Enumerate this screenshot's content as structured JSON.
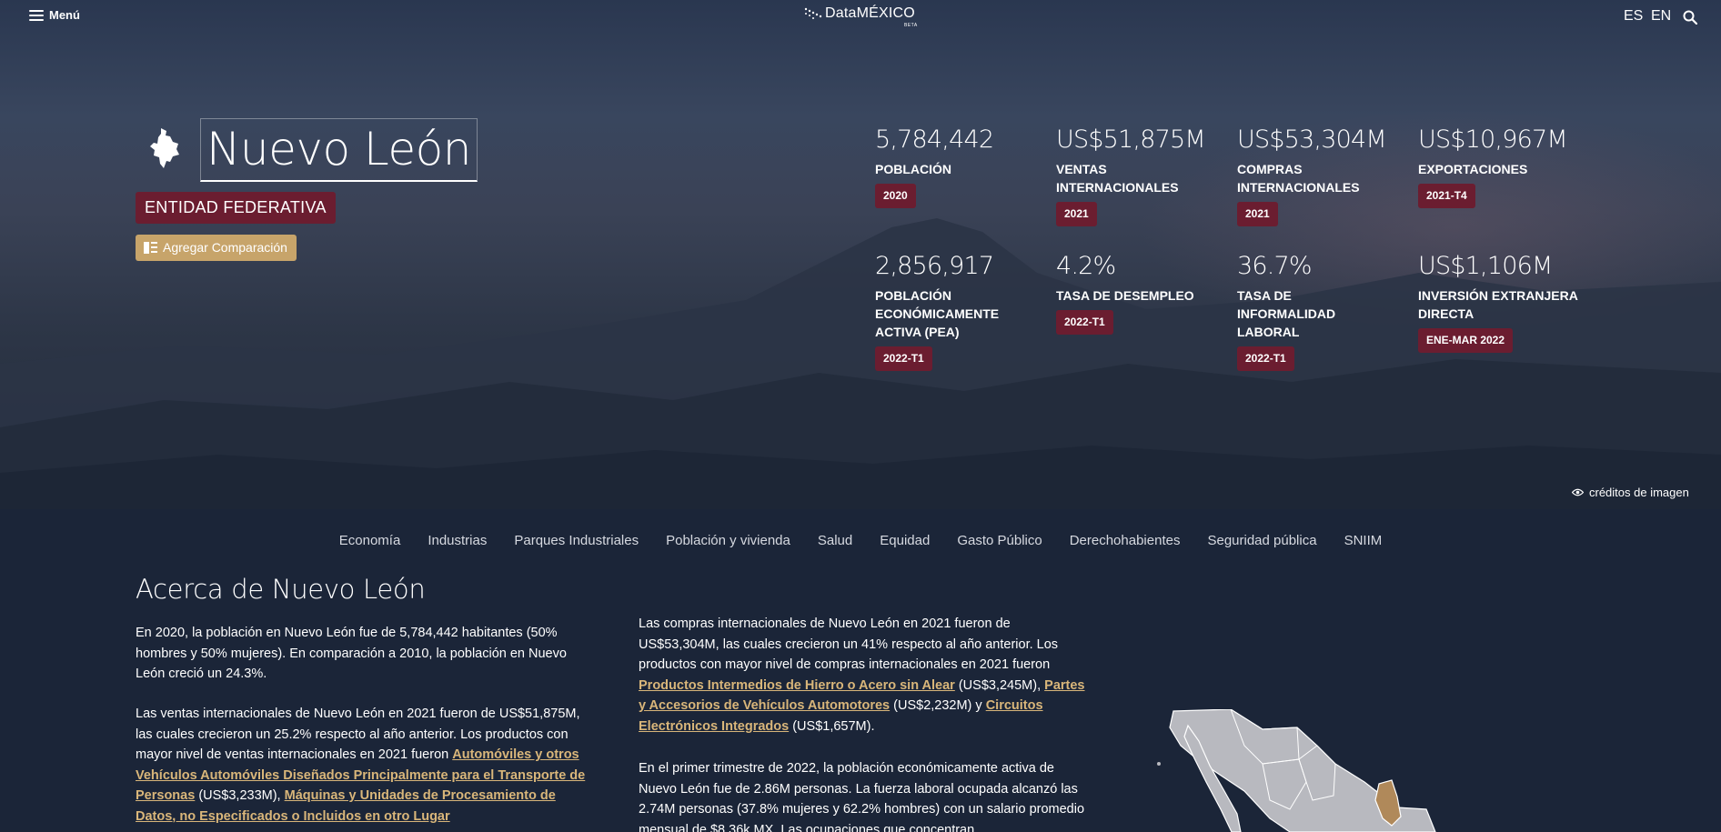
{
  "header": {
    "menu_label": "Menú",
    "logo_text": "DataMÉXICO",
    "logo_beta": "BETA",
    "lang_es": "ES",
    "lang_en": "EN"
  },
  "profile": {
    "title": "Nuevo León",
    "entity_type": "ENTIDAD FEDERATIVA",
    "compare_label": "Agregar Comparación"
  },
  "stats": [
    {
      "value": "5,784,442",
      "label": "POBLACIÓN",
      "badge": "2020"
    },
    {
      "value": "US$51,875M",
      "label": "VENTAS INTERNACIONALES",
      "badge": "2021"
    },
    {
      "value": "US$53,304M",
      "label": "COMPRAS INTERNACIONALES",
      "badge": "2021"
    },
    {
      "value": "US$10,967M",
      "label": "EXPORTACIONES",
      "badge": "2021-T4"
    },
    {
      "value": "2,856,917",
      "label": "POBLACIÓN ECONÓMICAMENTE ACTIVA (PEA)",
      "badge": "2022-T1"
    },
    {
      "value": "4.2%",
      "label": "TASA DE DESEMPLEO",
      "badge": "2022-T1"
    },
    {
      "value": "36.7%",
      "label": "TASA DE INFORMALIDAD LABORAL",
      "badge": "2022-T1"
    },
    {
      "value": "US$1,106M",
      "label": "INVERSIÓN EXTRANJERA DIRECTA",
      "badge": "ENE-MAR 2022"
    }
  ],
  "credits_label": "créditos de imagen",
  "nav": [
    "Economía",
    "Industrias",
    "Parques Industriales",
    "Población y vivienda",
    "Salud",
    "Equidad",
    "Gasto Público",
    "Derechohabientes",
    "Seguridad pública",
    "SNIIM"
  ],
  "about": {
    "title": "Acerca de Nuevo León",
    "p1": "En 2020, la población en Nuevo León fue de 5,784,442 habitantes (50% hombres y 50% mujeres). En comparación a 2010, la población en Nuevo León creció un 24.3%.",
    "p2_text": "Las ventas internacionales de Nuevo León en 2021 fueron de US$51,875M, las cuales crecieron un 25.2% respecto al año anterior. Los productos con mayor nivel de ventas internacionales en 2021 fueron ",
    "p2_link1": "Automóviles y otros Vehículos Automóviles Diseñados Principalmente para el Transporte de Personas",
    "p2_mid": " (US$3,233M), ",
    "p2_link2": "Máquinas y Unidades de Procesamiento de Datos, no Especificados o Incluidos en otro Lugar",
    "p3_text": "Las compras internacionales de Nuevo León en 2021 fueron de US$53,304M, las cuales crecieron un 41% respecto al año anterior. Los productos con mayor nivel de compras internacionales en 2021 fueron ",
    "p3_link1": "Productos Intermedios de Hierro o Acero sin Alear",
    "p3_mid1": " (US$3,245M), ",
    "p3_link2": "Partes y Accesorios de Vehículos Automotores",
    "p3_mid2": " (US$2,232M) y ",
    "p3_link3": "Circuitos Electrónicos Integrados",
    "p3_end": " (US$1,657M).",
    "p4": "En el primer trimestre de 2022, la población económicamente activa de Nuevo León fue de 2.86M personas. La fuerza laboral ocupada alcanzó las 2.74M personas (37.8% mujeres y 62.2% hombres) con un salario promedio mensual de $8.36k MX. Las ocupaciones que concentran"
  },
  "colors": {
    "badge": "#6b1d30",
    "compare_button": "#c7a46a",
    "link": "#d9b67a",
    "map_highlight": "#b0895a"
  }
}
